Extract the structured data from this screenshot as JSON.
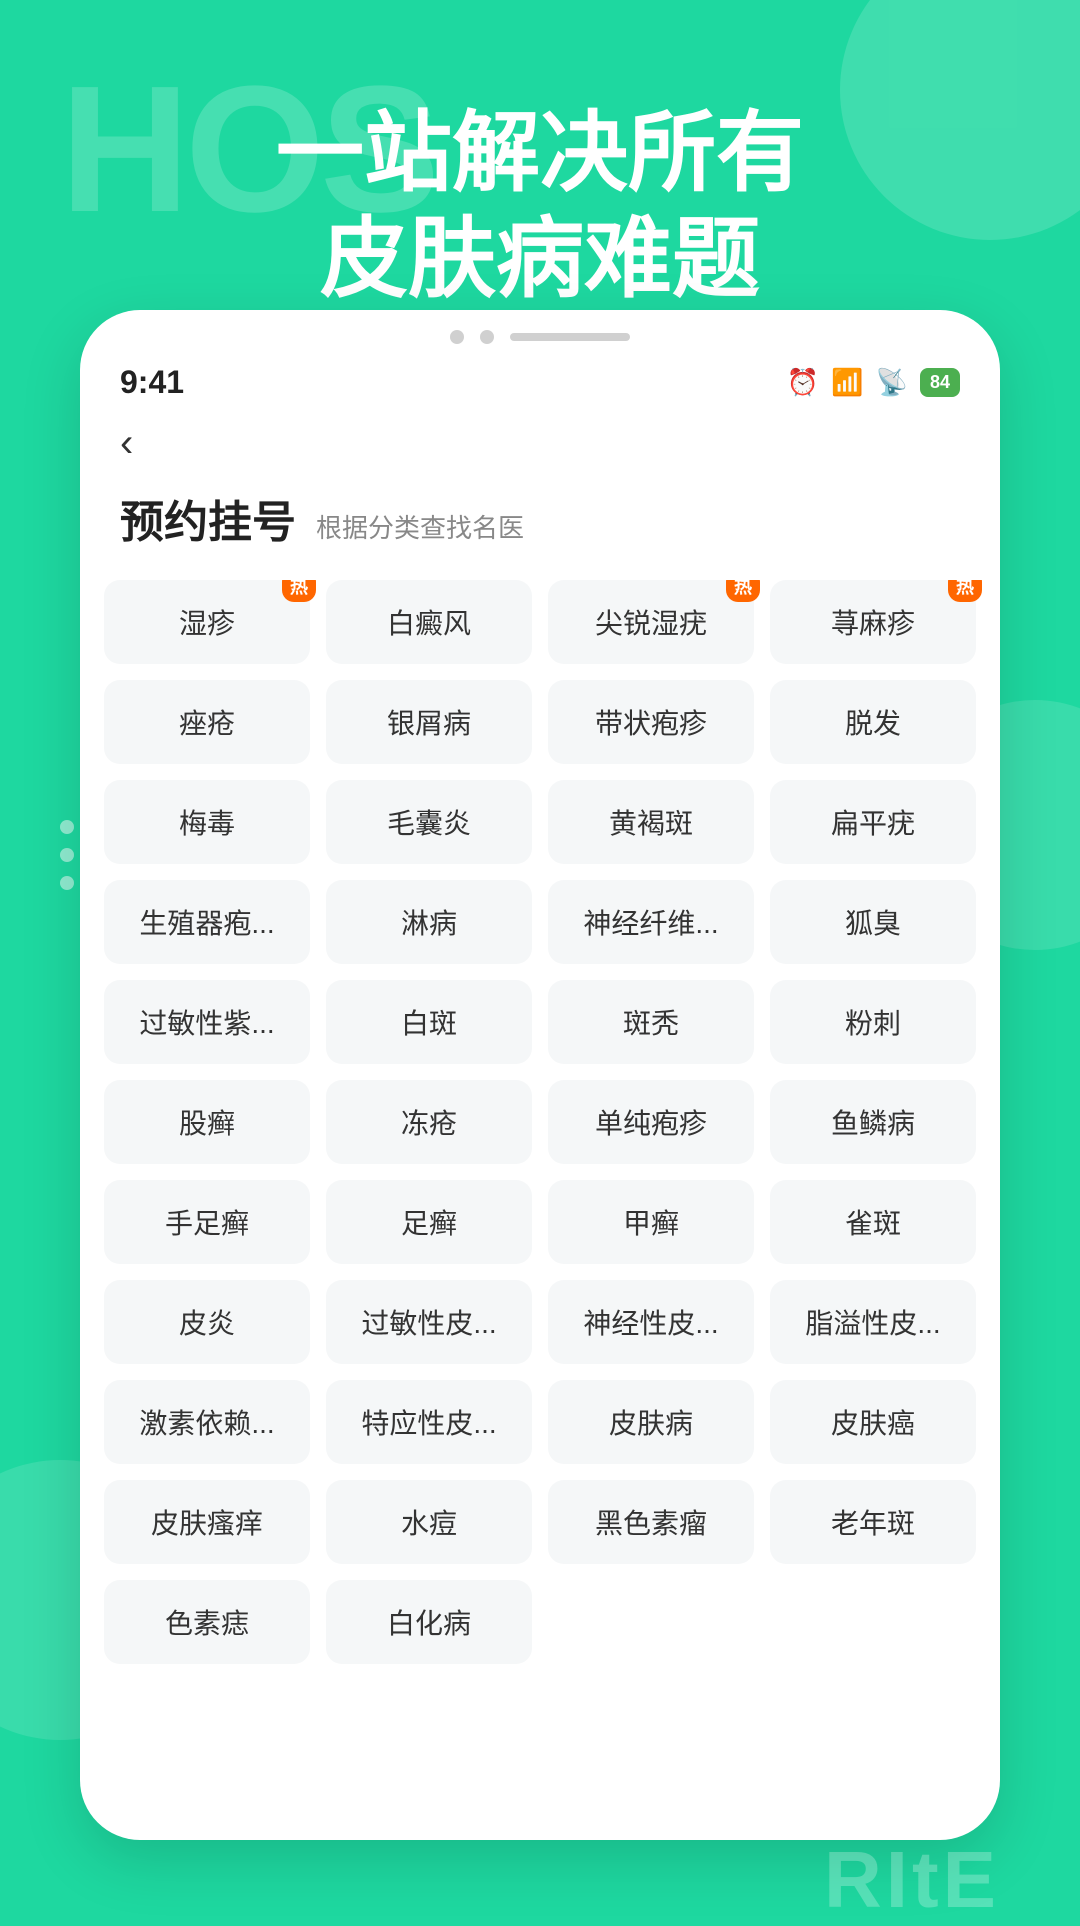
{
  "app": {
    "bg_color": "#1ed8a0",
    "bg_text": "HOS",
    "watermark": "RItE"
  },
  "hero": {
    "line1": "一站解决所有",
    "line2": "皮肤病难题"
  },
  "status_bar": {
    "time": "9:41",
    "battery": "84"
  },
  "page": {
    "title": "预约挂号",
    "subtitle": "根据分类查找名医",
    "back_label": "‹"
  },
  "conditions": [
    {
      "label": "湿疹",
      "hot": true
    },
    {
      "label": "白癜风",
      "hot": false
    },
    {
      "label": "尖锐湿疣",
      "hot": true
    },
    {
      "label": "荨麻疹",
      "hot": true
    },
    {
      "label": "痤疮",
      "hot": false
    },
    {
      "label": "银屑病",
      "hot": false
    },
    {
      "label": "带状疱疹",
      "hot": false
    },
    {
      "label": "脱发",
      "hot": false
    },
    {
      "label": "梅毒",
      "hot": false
    },
    {
      "label": "毛囊炎",
      "hot": false
    },
    {
      "label": "黄褐斑",
      "hot": false
    },
    {
      "label": "扁平疣",
      "hot": false
    },
    {
      "label": "生殖器疱...",
      "hot": false
    },
    {
      "label": "淋病",
      "hot": false
    },
    {
      "label": "神经纤维...",
      "hot": false
    },
    {
      "label": "狐臭",
      "hot": false
    },
    {
      "label": "过敏性紫...",
      "hot": false
    },
    {
      "label": "白斑",
      "hot": false
    },
    {
      "label": "斑秃",
      "hot": false
    },
    {
      "label": "粉刺",
      "hot": false
    },
    {
      "label": "股癣",
      "hot": false
    },
    {
      "label": "冻疮",
      "hot": false
    },
    {
      "label": "单纯疱疹",
      "hot": false
    },
    {
      "label": "鱼鳞病",
      "hot": false
    },
    {
      "label": "手足癣",
      "hot": false
    },
    {
      "label": "足癣",
      "hot": false
    },
    {
      "label": "甲癣",
      "hot": false
    },
    {
      "label": "雀斑",
      "hot": false
    },
    {
      "label": "皮炎",
      "hot": false
    },
    {
      "label": "过敏性皮...",
      "hot": false
    },
    {
      "label": "神经性皮...",
      "hot": false
    },
    {
      "label": "脂溢性皮...",
      "hot": false
    },
    {
      "label": "激素依赖...",
      "hot": false
    },
    {
      "label": "特应性皮...",
      "hot": false
    },
    {
      "label": "皮肤病",
      "hot": false
    },
    {
      "label": "皮肤癌",
      "hot": false
    },
    {
      "label": "皮肤瘙痒",
      "hot": false
    },
    {
      "label": "水痘",
      "hot": false
    },
    {
      "label": "黑色素瘤",
      "hot": false
    },
    {
      "label": "老年斑",
      "hot": false
    },
    {
      "label": "色素痣",
      "hot": false
    },
    {
      "label": "白化病",
      "hot": false
    }
  ],
  "hot_label": "热"
}
